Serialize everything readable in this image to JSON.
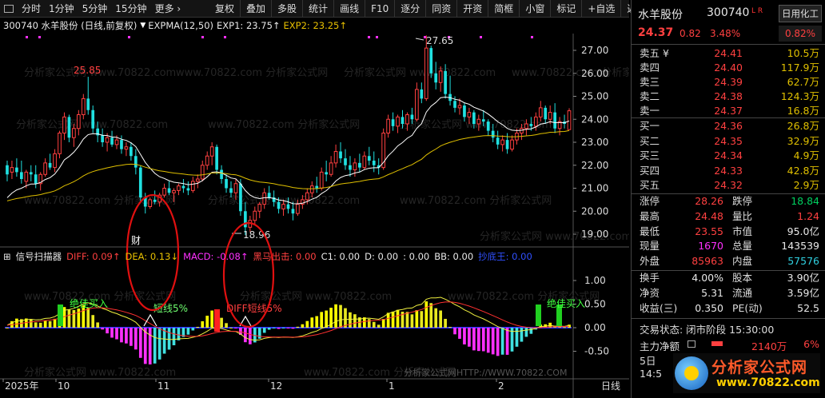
{
  "toolbar": {
    "periods": [
      "分时",
      "1分钟",
      "5分钟",
      "15分钟",
      "更多 ›"
    ],
    "actions": [
      "复权",
      "叠加",
      "多股",
      "统计",
      "画线",
      "F10",
      "逐分",
      "同资",
      "开资",
      "简框",
      "小窗",
      "标记",
      "+自选",
      "返回"
    ]
  },
  "chart_header": {
    "stock": "300740 水羊股份 (日线,前复权)",
    "indicator": "EXPMA(12,50)",
    "exp1_label": "EXP1: 23.75↑",
    "exp2_label": "EXP2: 23.25↑"
  },
  "ind_header": {
    "name": "信号扫描器",
    "diff": "DIFF: 0.09↑",
    "dea": "DEA: 0.13↓",
    "macd": "MACD: -0.08↑",
    "heima": "黑马出击: 0.00",
    "c1": "C1: 0.00",
    "d": "D: 0.00",
    "blank": ": 0.00",
    "bb": "BB: 0.00",
    "chao": "抄底王: 0.00"
  },
  "price_axis": [
    "27.00",
    "26.00",
    "25.00",
    "24.00",
    "23.00",
    "22.00",
    "21.00",
    "20.00",
    "19.00"
  ],
  "ind_axis": [
    "1.00",
    "0.50",
    "0.00",
    "-0.50"
  ],
  "date_axis": [
    "2025年",
    "10",
    "11",
    "12",
    "1",
    "2"
  ],
  "date_axis_right": "日线",
  "annotations": {
    "high_left": "25.85",
    "high_right": "27.65",
    "low": "18.96",
    "cai": "财",
    "buy1": "绝佳买入",
    "short1": "短线5%",
    "diff_short": "DIFF短线5%",
    "buy2": "绝佳买入"
  },
  "watermarks": [
    "分析家公式网",
    "www.70822.com",
    "分析家公式网HTTP://WWW.70822.COM"
  ],
  "panel": {
    "name": "水羊股份",
    "code": "300740",
    "lr": "L R",
    "btn": "日用化工",
    "price": "24.37",
    "change": "0.82",
    "pct": "3.48%",
    "sector_pct": "0.82%",
    "asks": [
      {
        "label": "卖五 ¥",
        "price": "24.41",
        "vol": "10.5万"
      },
      {
        "label": "卖四",
        "price": "24.40",
        "vol": "117.9万"
      },
      {
        "label": "卖三",
        "price": "24.39",
        "vol": "62.7万"
      },
      {
        "label": "卖二",
        "price": "24.38",
        "vol": "124.3万"
      },
      {
        "label": "卖一",
        "price": "24.37",
        "vol": "16.8万"
      }
    ],
    "bids": [
      {
        "label": "买一",
        "price": "24.36",
        "vol": "26.8万"
      },
      {
        "label": "买二",
        "price": "24.35",
        "vol": "32.9万"
      },
      {
        "label": "买三",
        "price": "24.34",
        "vol": "4.9万"
      },
      {
        "label": "买四",
        "price": "24.33",
        "vol": "42.8万"
      },
      {
        "label": "买五",
        "price": "24.32",
        "vol": "2.9万"
      }
    ],
    "quote": [
      {
        "a": "涨停",
        "b": "28.26",
        "c": "跌停",
        "d": "18.84"
      },
      {
        "a": "最高",
        "b": "24.48",
        "c": "量比",
        "d": "1.24"
      },
      {
        "a": "最低",
        "b": "23.55",
        "c": "市值",
        "d": "95.0亿"
      },
      {
        "a": "现量",
        "b": "1670",
        "c": "总量",
        "d": "143539"
      },
      {
        "a": "外盘",
        "b": "85963",
        "c": "内盘",
        "d": "57576"
      }
    ],
    "fin": [
      {
        "a": "换手",
        "b": "4.00%",
        "c": "股本",
        "d": "3.90亿"
      },
      {
        "a": "净资",
        "b": "5.31",
        "c": "流通",
        "d": "3.59亿"
      },
      {
        "a": "收益(三)",
        "b": "0.350",
        "c": "PE(动)",
        "d": "52.5"
      }
    ],
    "status": "交易状态: 闭市阶段 15:30:00",
    "net_label": "主力净额",
    "net_value": "2140万",
    "net_pct": "6%",
    "day": "5日",
    "trunc": "14:5",
    "logo_text": "分析家公式网",
    "logo_url": "www.70822.com"
  },
  "colors": {
    "up": "#ff4040",
    "down": "#20e0e0",
    "exp1": "#ffffff",
    "exp2": "#e0c000",
    "diff": "#f0f040",
    "dea": "#ff3030",
    "macd_pos": "#ffff00",
    "macd_neg": "#ff30ff"
  }
}
